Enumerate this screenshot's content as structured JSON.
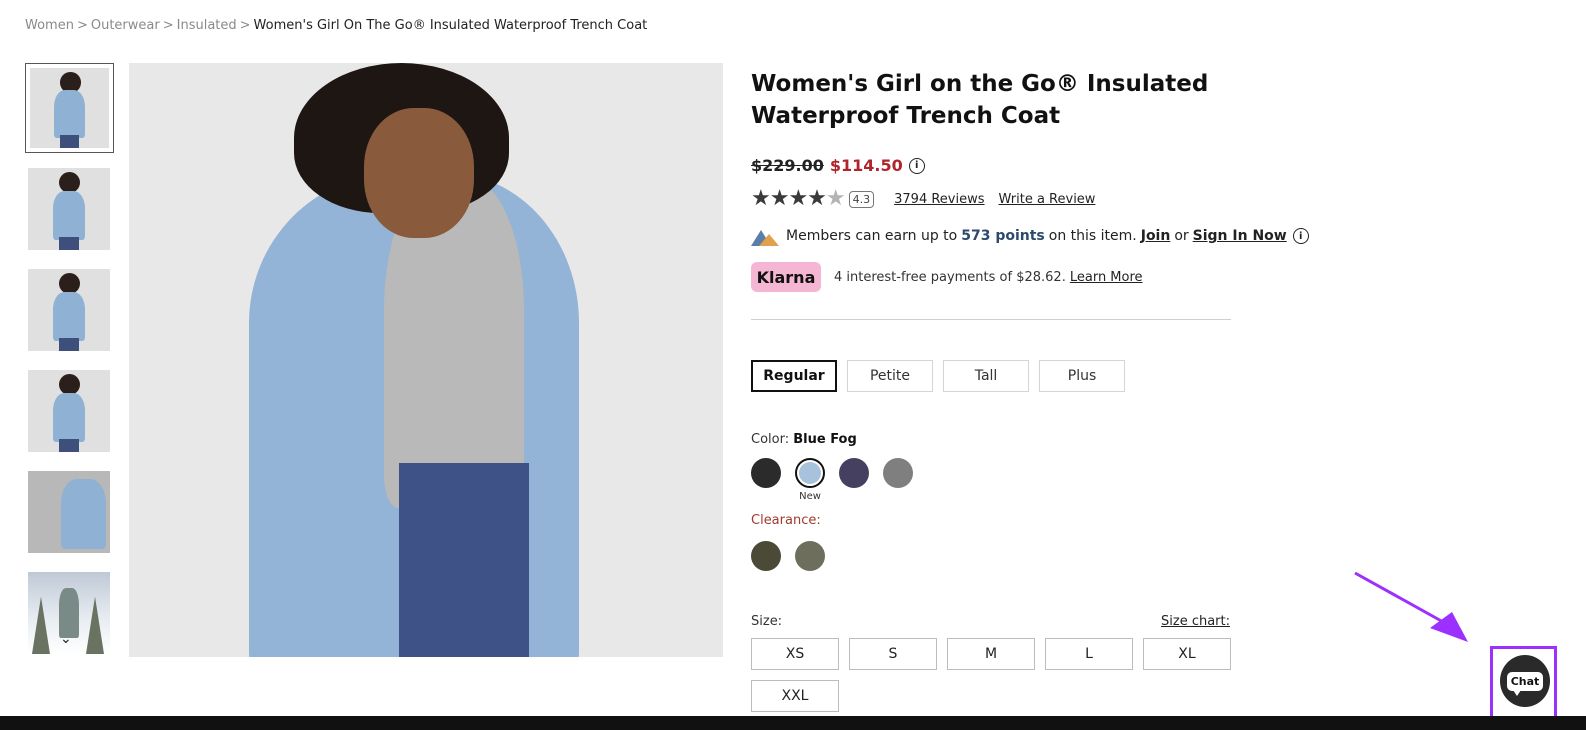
{
  "breadcrumb": {
    "items": [
      "Women",
      "Outerwear",
      "Insulated"
    ],
    "current": "Women's Girl On The Go® Insulated Waterproof Trench Coat",
    "separator": ">"
  },
  "gallery": {
    "thumbnails": 6,
    "scroll_down_label": "⌄"
  },
  "product": {
    "title": "Women's Girl on the Go® Insulated Waterproof Trench Coat",
    "price_original": "$229.00",
    "price_sale": "$114.50",
    "price_info_icon": "i",
    "rating_value": "4.3",
    "rating_stars": 4.3,
    "reviews_link": "3794 Reviews",
    "write_review_link": "Write a Review"
  },
  "members": {
    "text_before": "Members can earn up to",
    "points": "573 points",
    "text_after": "on this item.",
    "join_link": "Join",
    "or": "or",
    "sign_in_link": "Sign In Now",
    "info_icon": "i"
  },
  "klarna": {
    "badge": "Klarna",
    "text": "4 interest-free payments of $28.62.",
    "learn_more": "Learn More"
  },
  "fit_options": [
    {
      "label": "Regular",
      "selected": true
    },
    {
      "label": "Petite",
      "selected": false
    },
    {
      "label": "Tall",
      "selected": false
    },
    {
      "label": "Plus",
      "selected": false
    }
  ],
  "color": {
    "label": "Color:",
    "selected_name": "Blue Fog",
    "swatches": [
      {
        "color": "#2b2b2b"
      },
      {
        "color": "#a9c2dc",
        "tag": "New",
        "selected": true
      },
      {
        "color": "#464060"
      },
      {
        "color": "#7f7f7f"
      }
    ],
    "clearance_label": "Clearance:",
    "clearance_swatches": [
      {
        "color": "#4a4a36"
      },
      {
        "color": "#6e6e5c"
      }
    ]
  },
  "size": {
    "label": "Size:",
    "chart_link": "Size chart:",
    "options": [
      "XS",
      "S",
      "M",
      "L",
      "XL",
      "XXL"
    ]
  },
  "chat": {
    "label": "Chat",
    "highlight_color": "#9b30ff"
  }
}
